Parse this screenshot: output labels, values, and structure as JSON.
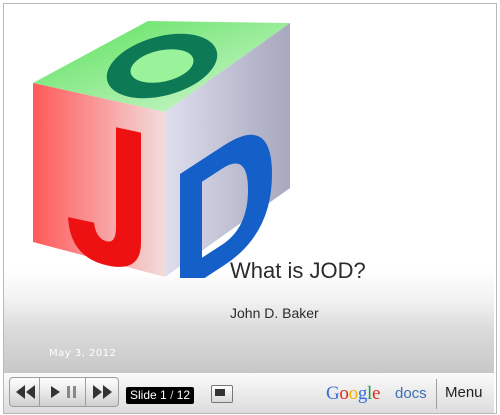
{
  "slide": {
    "logo_letters": {
      "top": "O",
      "left": "J",
      "right": "D"
    },
    "title": "What is JOD?",
    "subtitle": "John D. Baker",
    "date": "May 3, 2012"
  },
  "toolbar": {
    "counter_prefix": "Slide",
    "current_slide": "1",
    "total_slides": "12",
    "brand_letters": [
      "G",
      "o",
      "o",
      "g",
      "l",
      "e"
    ],
    "brand_suffix": "docs",
    "menu_label": "Menu"
  },
  "colors": {
    "top_face": "#66e866",
    "left_face": "#ff6a6a",
    "right_face": "#c7c7dd",
    "letter_o": "#0d7a55",
    "letter_j": "#ee1111",
    "letter_d": "#1460c8",
    "google": [
      "#3a6fd8",
      "#d62d20",
      "#f4b400",
      "#3a6fd8",
      "#1a9e3a",
      "#d62d20"
    ]
  },
  "icons": [
    "rewind-icon",
    "play-icon",
    "pause-icon",
    "fast-forward-icon",
    "screen-icon"
  ]
}
